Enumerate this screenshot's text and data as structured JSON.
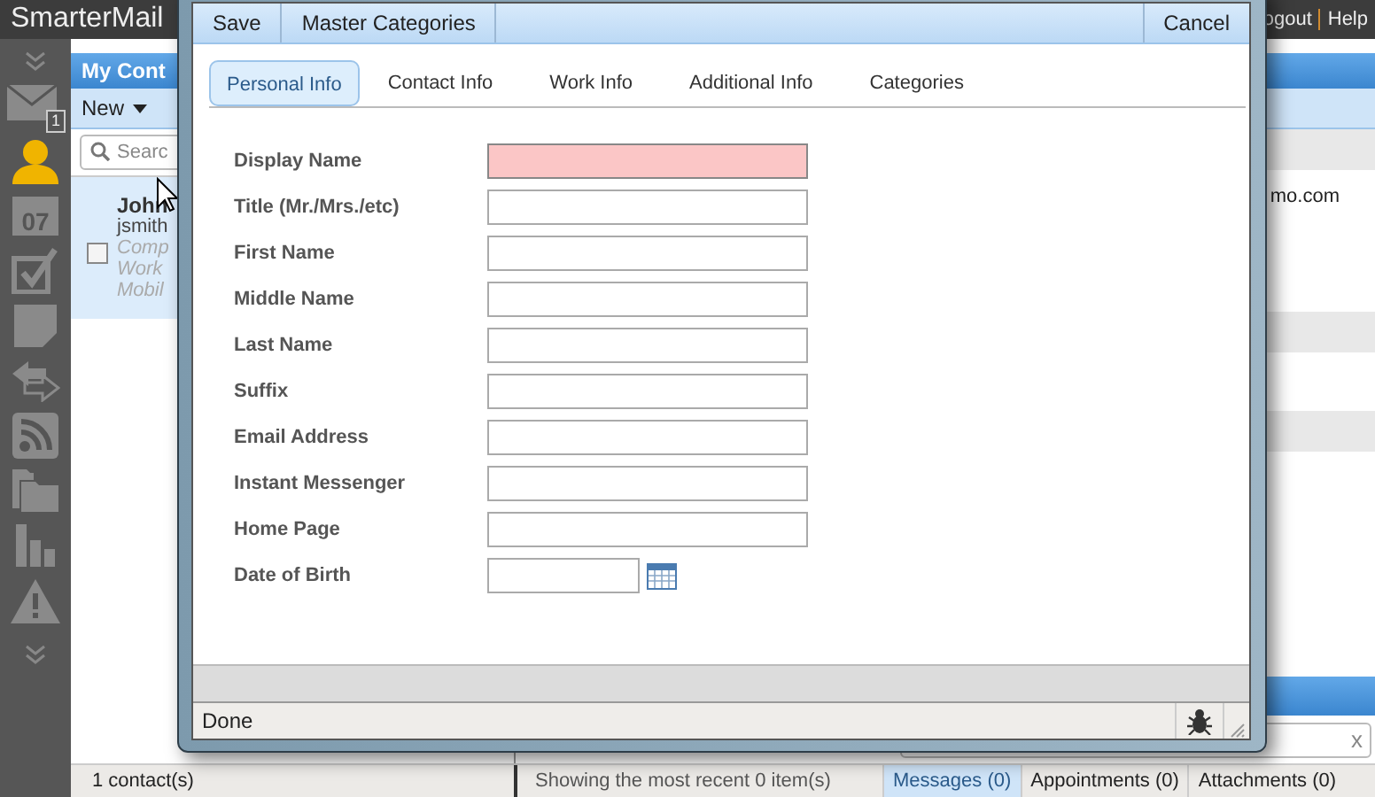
{
  "app": {
    "title": "SmarterMail",
    "links": [
      "ogout",
      "Help"
    ]
  },
  "rail": [
    {
      "kind": "collapse",
      "selected": false
    },
    {
      "kind": "mail",
      "badge": "1",
      "selected": false
    },
    {
      "kind": "contacts",
      "selected": true
    },
    {
      "kind": "calendar",
      "label": "07",
      "selected": false
    },
    {
      "kind": "tasks",
      "selected": false
    },
    {
      "kind": "notes",
      "selected": false
    },
    {
      "kind": "sync",
      "selected": false
    },
    {
      "kind": "rss",
      "selected": false
    },
    {
      "kind": "folders",
      "selected": false
    },
    {
      "kind": "reports",
      "selected": false
    },
    {
      "kind": "alerts",
      "selected": false
    },
    {
      "kind": "expand",
      "selected": false
    }
  ],
  "list_pane": {
    "title": "My Cont",
    "new_button": "New",
    "search": {
      "placeholder": "Searc"
    },
    "contact": {
      "name": "John",
      "email": "jsmith",
      "lines": [
        "Comp",
        "Work",
        "Mobil"
      ],
      "checked": false
    }
  },
  "detail_pane": {
    "email": "mo.com"
  },
  "bottom_search": {
    "clear": "x"
  },
  "dialog": {
    "toolbar": [
      "Save",
      "Master Categories"
    ],
    "cancel": "Cancel",
    "tabs": [
      {
        "label": "Personal Info",
        "selected": true
      },
      {
        "label": "Contact Info",
        "selected": false
      },
      {
        "label": "Work Info",
        "selected": false
      },
      {
        "label": "Additional Info",
        "selected": false
      },
      {
        "label": "Categories",
        "selected": false
      }
    ],
    "fields": [
      {
        "label": "Display Name",
        "kind": "text",
        "invalid": true
      },
      {
        "label": "Title (Mr./Mrs./etc)",
        "kind": "text",
        "invalid": false
      },
      {
        "label": "First Name",
        "kind": "text",
        "invalid": false
      },
      {
        "label": "Middle Name",
        "kind": "text",
        "invalid": false
      },
      {
        "label": "Last Name",
        "kind": "text",
        "invalid": false
      },
      {
        "label": "Suffix",
        "kind": "text",
        "invalid": false
      },
      {
        "label": "Email Address",
        "kind": "text",
        "invalid": false
      },
      {
        "label": "Instant Messenger",
        "kind": "text",
        "invalid": false
      },
      {
        "label": "Home Page",
        "kind": "text",
        "invalid": false
      },
      {
        "label": "Date of Birth",
        "kind": "date",
        "invalid": false
      }
    ],
    "status": "Done"
  },
  "status_bar": {
    "count": "1 contact(s)",
    "info": "Showing the most recent 0 item(s)",
    "tabs": [
      {
        "label": "Messages (0)",
        "selected": true
      },
      {
        "label": "Appointments (0)",
        "selected": false
      },
      {
        "label": "Attachments (0)",
        "selected": false
      }
    ]
  }
}
